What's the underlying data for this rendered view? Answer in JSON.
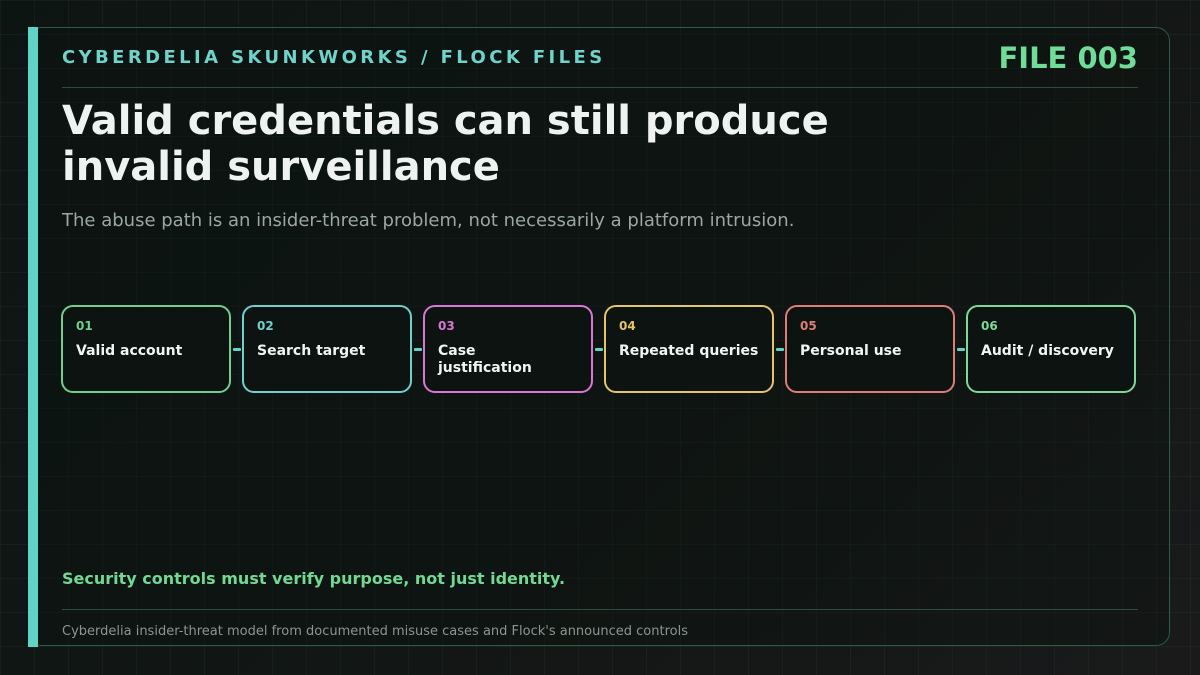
{
  "header": {
    "kicker": "CYBERDELIA SKUNKWORKS / FLOCK FILES",
    "file_label": "FILE 003"
  },
  "title": "Valid credentials can still produce invalid surveillance",
  "subtitle": "The abuse path is an insider-threat problem, not necessarily a platform intrusion.",
  "flow": {
    "connector_color": "#5fd4c6",
    "steps": [
      {
        "num": "01",
        "label": "Valid account",
        "color": "#6fcf8f"
      },
      {
        "num": "02",
        "label": "Search target",
        "color": "#6fd0cc"
      },
      {
        "num": "03",
        "label": "Case justification",
        "color": "#d977d6"
      },
      {
        "num": "04",
        "label": "Repeated queries",
        "color": "#e6c46a"
      },
      {
        "num": "05",
        "label": "Personal use",
        "color": "#e07d78"
      },
      {
        "num": "06",
        "label": "Audit / discovery",
        "color": "#7fd89a"
      }
    ]
  },
  "takeaway": "Security controls must verify purpose, not just identity.",
  "footer": "Cyberdelia insider-threat model from documented misuse cases and Flock's announced controls",
  "colors": {
    "accent": "#5fd4c6",
    "green": "#6fdc97",
    "background": "#101412"
  }
}
